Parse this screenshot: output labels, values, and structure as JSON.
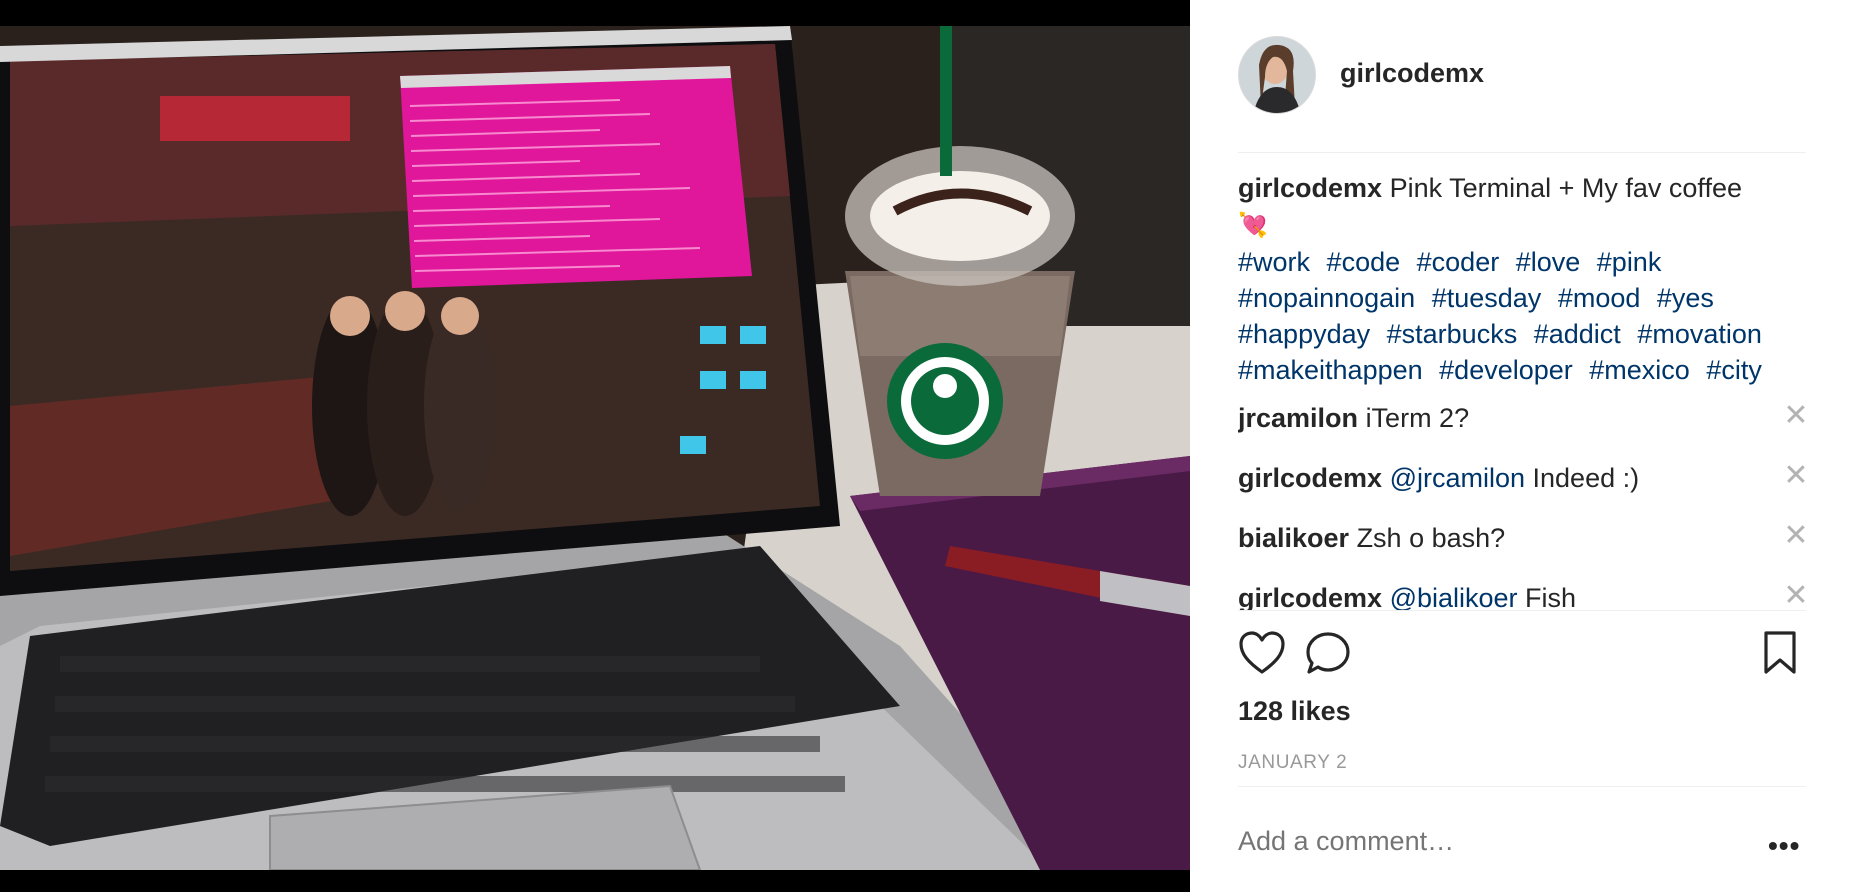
{
  "post": {
    "username": "girlcodemx",
    "caption_text": "Pink Terminal + My fav coffee",
    "caption_emoji": "💘",
    "hashtags": [
      "#work",
      "#code",
      "#coder",
      "#love",
      "#pink",
      "#nopainnogain",
      "#tuesday",
      "#mood",
      "#yes",
      "#happyday",
      "#starbucks",
      "#addict",
      "#movation",
      "#makeithappen",
      "#developer",
      "#mexico",
      "#city"
    ]
  },
  "comments": [
    {
      "user": "jrcamilon",
      "mention": "",
      "text": "iTerm 2?"
    },
    {
      "user": "girlcodemx",
      "mention": "@jrcamilon",
      "text": "Indeed :)"
    },
    {
      "user": "bialikoer",
      "mention": "",
      "text": "Zsh o bash?"
    },
    {
      "user": "girlcodemx",
      "mention": "@bialikoer",
      "text": "Fish"
    }
  ],
  "likes": "128 likes",
  "date": "JANUARY 2",
  "add_comment_placeholder": "Add a comment…",
  "icons": {
    "like": "heart-icon",
    "comment": "comment-bubble-icon",
    "save": "bookmark-icon",
    "delete": "close-icon",
    "more": "more-options-icon"
  }
}
